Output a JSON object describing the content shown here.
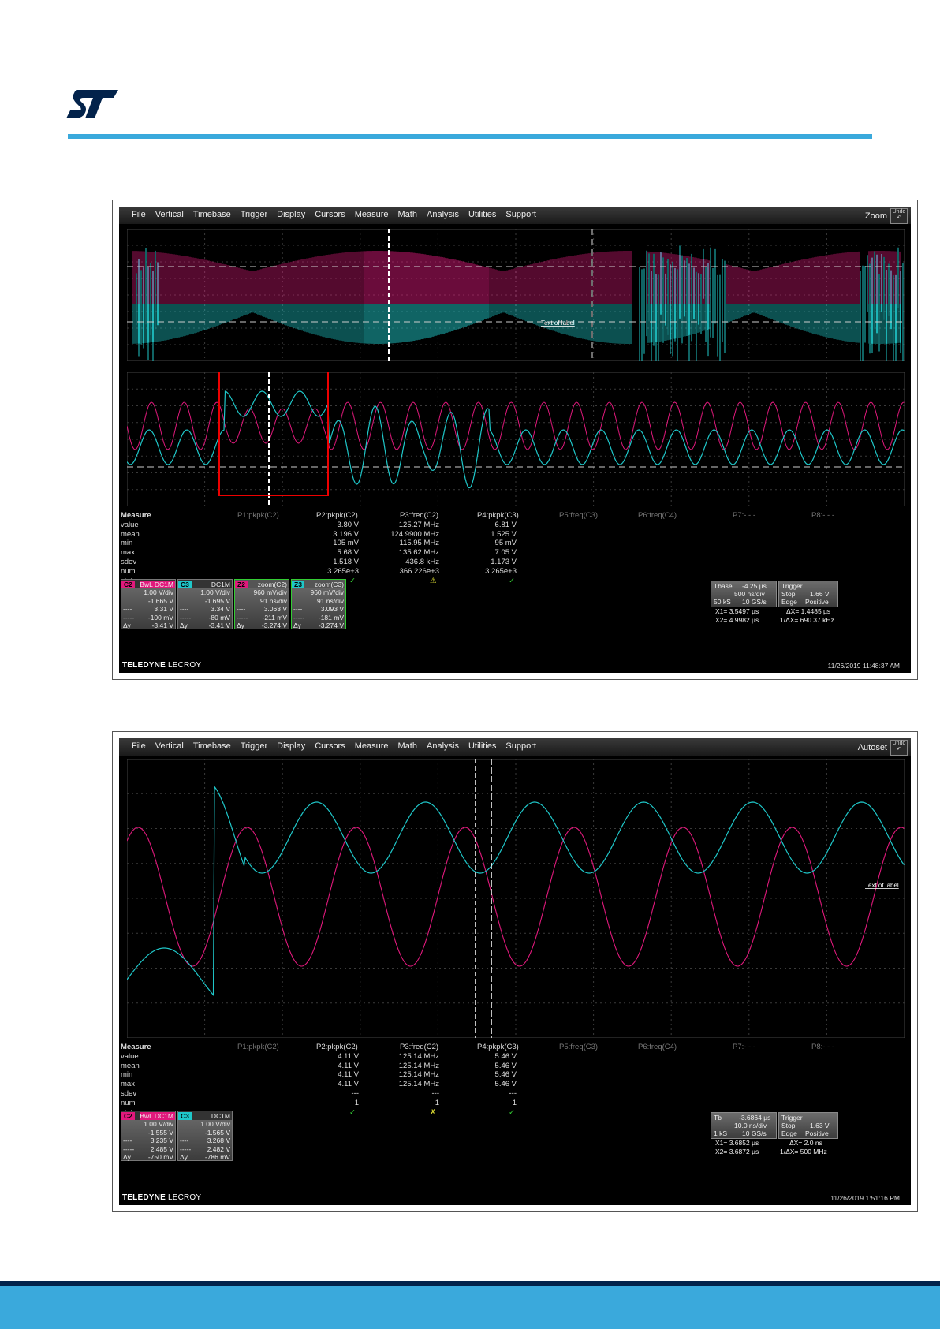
{
  "colors": {
    "c2": "#e0197c",
    "c3": "#1fc7c9",
    "accent": "#3aa9dc",
    "footer": "#03234b"
  },
  "menu": [
    "File",
    "Vertical",
    "Timebase",
    "Trigger",
    "Display",
    "Cursors",
    "Measure",
    "Math",
    "Analysis",
    "Utilities",
    "Support"
  ],
  "undo": "Undo",
  "brand1": "TELEDYNE",
  "brand2": "LECROY",
  "scope1": {
    "menu_right": "Zoom",
    "trace_label": "Text of label",
    "measure": {
      "title": "Measure",
      "params": [
        "P1:pkpk(C2)",
        "P2:pkpk(C2)",
        "P3:freq(C2)",
        "P4:pkpk(C3)",
        "P5:freq(C3)",
        "P6:freq(C4)",
        "P7:- - -",
        "P8:- - -"
      ],
      "rows": [
        "value",
        "mean",
        "min",
        "max",
        "sdev",
        "num",
        "status"
      ],
      "p2": [
        "3.80 V",
        "3.196 V",
        "105 mV",
        "5.68 V",
        "1.518 V",
        "3.265e+3"
      ],
      "p3": [
        "125.27 MHz",
        "124.9900 MHz",
        "115.95 MHz",
        "135.62 MHz",
        "436.8 kHz",
        "366.226e+3"
      ],
      "p4": [
        "6.81 V",
        "1.525 V",
        "95 mV",
        "7.05 V",
        "1.173 V",
        "3.265e+3"
      ],
      "status": [
        "✓",
        "⚠",
        "✓"
      ]
    },
    "channels": [
      {
        "tag": "C2",
        "mode": "BwL DC1M",
        "vdiv": "1.00 V/div",
        "ofs": "-1.665 V",
        "a": "3.31 V",
        "b": "-100 mV",
        "dy": "-3.41 V"
      },
      {
        "tag": "C3",
        "mode": "DC1M",
        "vdiv": "1.00 V/div",
        "ofs": "-1.695 V",
        "a": "3.34 V",
        "b": "-80 mV",
        "dy": "-3.41 V"
      },
      {
        "tag": "Z2",
        "mode": "zoom(C2)",
        "vdiv": "960 mV/div",
        "ofs": "91 ns/div",
        "a": "3.063 V",
        "b": "-211 mV",
        "dy": "-3.274 V"
      },
      {
        "tag": "Z3",
        "mode": "zoom(C3)",
        "vdiv": "960 mV/div",
        "ofs": "91 ns/div",
        "a": "3.093 V",
        "b": "-181 mV",
        "dy": "-3.274 V"
      }
    ],
    "tbase": {
      "label": "Tbase",
      "val": "-4.25 µs",
      "tdiv": "500 ns/div",
      "samp": "50 kS",
      "rate": "10 GS/s"
    },
    "trigger": {
      "label": "Trigger",
      "mode": "Stop",
      "level": "1.66 V",
      "type": "Edge",
      "slope": "Positive"
    },
    "cursors": {
      "x1": "X1= 3.5497 µs",
      "dx": "ΔX= 1.4485 µs",
      "x2": "X2= 4.9982 µs",
      "idx": "1/ΔX= 690.37 kHz"
    },
    "timestamp": "11/26/2019 11:48:37 AM"
  },
  "scope2": {
    "menu_right": "Autoset",
    "trace_label": "Text of label",
    "measure": {
      "title": "Measure",
      "params": [
        "P1:pkpk(C2)",
        "P2:pkpk(C2)",
        "P3:freq(C2)",
        "P4:pkpk(C3)",
        "P5:freq(C3)",
        "P6:freq(C4)",
        "P7:- - -",
        "P8:- - -"
      ],
      "rows": [
        "value",
        "mean",
        "min",
        "max",
        "sdev",
        "num",
        "status"
      ],
      "p2": [
        "4.11 V",
        "4.11 V",
        "4.11 V",
        "4.11 V",
        "---",
        "1"
      ],
      "p3": [
        "125.14 MHz",
        "125.14 MHz",
        "125.14 MHz",
        "125.14 MHz",
        "---",
        "1"
      ],
      "p4": [
        "5.46 V",
        "5.46 V",
        "5.46 V",
        "5.46 V",
        "---",
        "1"
      ],
      "status": [
        "✓",
        "✗",
        "✓"
      ]
    },
    "channels": [
      {
        "tag": "C2",
        "mode": "BwL DC1M",
        "vdiv": "1.00 V/div",
        "ofs": "-1.555 V",
        "a": "3.235 V",
        "b": "2.485 V",
        "dy": "-750 mV"
      },
      {
        "tag": "C3",
        "mode": "DC1M",
        "vdiv": "1.00 V/div",
        "ofs": "-1.565 V",
        "a": "3.268 V",
        "b": "2.482 V",
        "dy": "-786 mV"
      }
    ],
    "tbase": {
      "label": "Tb",
      "val": "-3.6864 µs",
      "tdiv": "10.0 ns/div",
      "samp": "1 kS",
      "rate": "10 GS/s"
    },
    "trigger": {
      "label": "Trigger",
      "mode": "Stop",
      "level": "1.63 V",
      "type": "Edge",
      "slope": "Positive"
    },
    "cursors": {
      "x1": "X1= 3.6852 µs",
      "dx": "ΔX= 2.0 ns",
      "x2": "X2= 3.6872 µs",
      "idx": "1/ΔX= 500 MHz"
    },
    "timestamp": "11/26/2019 1:51:16 PM"
  }
}
